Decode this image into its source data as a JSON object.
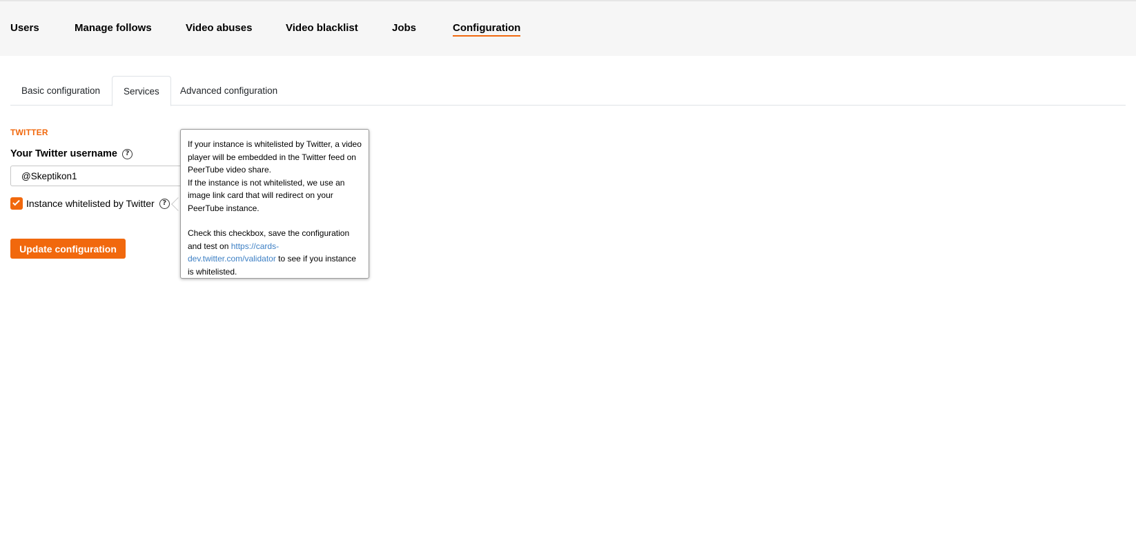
{
  "topnav": {
    "items": [
      {
        "label": "Users"
      },
      {
        "label": "Manage follows"
      },
      {
        "label": "Video abuses"
      },
      {
        "label": "Video blacklist"
      },
      {
        "label": "Jobs"
      },
      {
        "label": "Configuration",
        "active": true
      }
    ]
  },
  "tabs": [
    {
      "label": "Basic configuration"
    },
    {
      "label": "Services",
      "active": true
    },
    {
      "label": "Advanced configuration"
    }
  ],
  "twitter": {
    "section_title": "TWITTER",
    "username_label": "Your Twitter username",
    "username_value": "@Skeptikon1",
    "whitelisted_label": "Instance whitelisted by Twitter",
    "whitelisted_checked": true
  },
  "update_button": "Update configuration",
  "popover": {
    "line1": "If your instance is whitelisted by Twitter, a video player will be embedded in the Twitter feed on PeerTube video share.",
    "line2": "If the instance is not whitelisted, we use an image link card that will redirect on your PeerTube instance.",
    "line3_before": "Check this checkbox, save the configuration and test on ",
    "link": "https://cards-dev.twitter.com/validator",
    "line3_after": " to see if you instance is whitelisted."
  },
  "icons": {
    "help": "question-circle-icon",
    "check": "check-icon"
  },
  "colors": {
    "accent": "#f1680d",
    "link": "#3c7fc4"
  }
}
